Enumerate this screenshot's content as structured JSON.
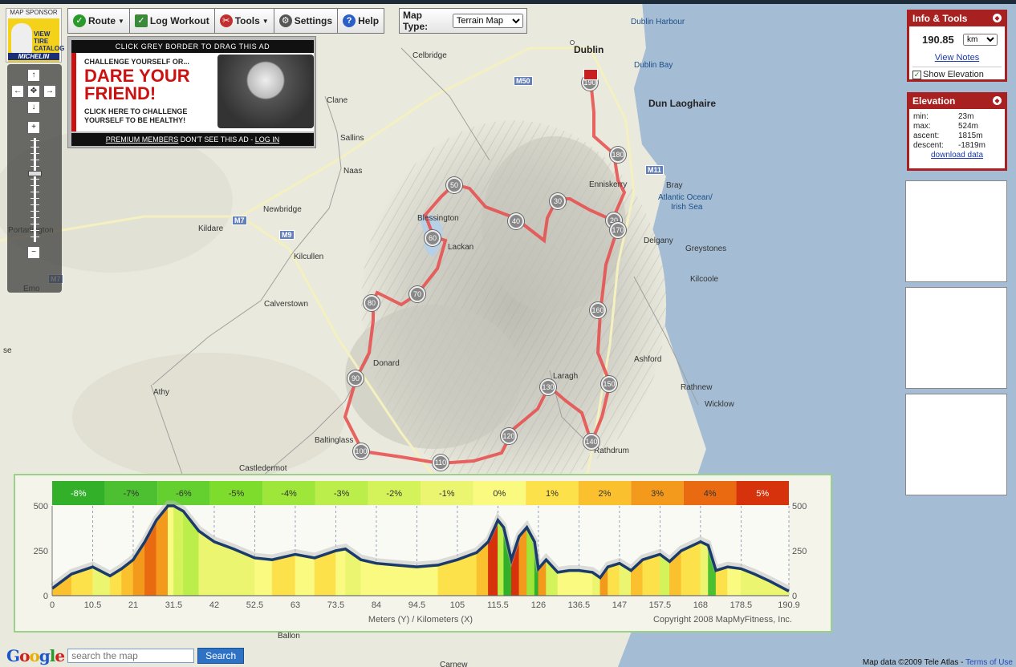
{
  "sponsor": {
    "label": "MAP SPONSOR",
    "cta": "VIEW TIRE CATALOG",
    "brand": "MICHELIN"
  },
  "toolbar": {
    "items": [
      {
        "label": "Route",
        "icon": "check-icon",
        "has_menu": true
      },
      {
        "label": "Log Workout",
        "icon": "clipboard-check-icon",
        "has_menu": false
      },
      {
        "label": "Tools",
        "icon": "tools-icon",
        "has_menu": true
      },
      {
        "label": "Settings",
        "icon": "gear-icon",
        "has_menu": false
      },
      {
        "label": "Help",
        "icon": "help-icon",
        "has_menu": false
      }
    ],
    "map_type_label": "Map Type:",
    "map_type_value": "Terrain Map"
  },
  "ad": {
    "header": "CLICK GREY BORDER TO DRAG THIS AD",
    "line1": "CHALLENGE YOURSELF OR...",
    "headline": "DARE YOUR FRIEND!",
    "line3": "CLICK HERE TO CHALLENGE YOURSELF TO BE HEALTHY!",
    "footer_link1": "PREMIUM MEMBERS",
    "footer_mid": " DON'T SEE THIS AD - ",
    "footer_link2": "LOG IN"
  },
  "info_tools": {
    "title": "Info & Tools",
    "distance": "190.85",
    "unit": "km",
    "view_notes": "View Notes",
    "show_elevation": "Show Elevation",
    "show_elevation_checked": true
  },
  "elevation": {
    "title": "Elevation",
    "rows": [
      {
        "k": "min:",
        "v": "23m"
      },
      {
        "k": "max:",
        "v": "524m"
      },
      {
        "k": "ascent:",
        "v": "1815m"
      },
      {
        "k": "descent:",
        "v": "-1819m"
      }
    ],
    "download": "download data"
  },
  "places": [
    {
      "name": "Dublin",
      "cls": "big"
    },
    {
      "name": "Dublin Harbour",
      "cls": "sea"
    },
    {
      "name": "Dublin Bay",
      "cls": "sea"
    },
    {
      "name": "Dun Laoghaire",
      "cls": "big"
    },
    {
      "name": "Celbridge",
      "cls": ""
    },
    {
      "name": "Clane",
      "cls": ""
    },
    {
      "name": "Sallins",
      "cls": ""
    },
    {
      "name": "Naas",
      "cls": ""
    },
    {
      "name": "Newbridge",
      "cls": ""
    },
    {
      "name": "Kildare",
      "cls": ""
    },
    {
      "name": "Portarlington",
      "cls": ""
    },
    {
      "name": "Kilcullen",
      "cls": ""
    },
    {
      "name": "Calverstown",
      "cls": ""
    },
    {
      "name": "Blessington",
      "cls": ""
    },
    {
      "name": "Lackan",
      "cls": ""
    },
    {
      "name": "Enniskerry",
      "cls": ""
    },
    {
      "name": "Bray",
      "cls": ""
    },
    {
      "name": "Atlantic Ocean/",
      "cls": "sea"
    },
    {
      "name": "Irish Sea",
      "cls": "sea"
    },
    {
      "name": "Delgany",
      "cls": ""
    },
    {
      "name": "Greystones",
      "cls": ""
    },
    {
      "name": "Kilcoole",
      "cls": ""
    },
    {
      "name": "Ashford",
      "cls": ""
    },
    {
      "name": "Rathnew",
      "cls": ""
    },
    {
      "name": "Wicklow",
      "cls": ""
    },
    {
      "name": "Laragh",
      "cls": ""
    },
    {
      "name": "Rathdrum",
      "cls": ""
    },
    {
      "name": "Donard",
      "cls": ""
    },
    {
      "name": "Athy",
      "cls": ""
    },
    {
      "name": "Baltinglass",
      "cls": ""
    },
    {
      "name": "Castledermot",
      "cls": ""
    },
    {
      "name": "Ballon",
      "cls": ""
    },
    {
      "name": "Carnew",
      "cls": ""
    },
    {
      "name": "Emo",
      "cls": ""
    },
    {
      "name": "se",
      "cls": ""
    }
  ],
  "road_shields": [
    "M50",
    "M11",
    "M7",
    "M9",
    "M7"
  ],
  "km_markers": [
    "190",
    "180",
    "30",
    "20",
    "170",
    "50",
    "40",
    "60",
    "70",
    "80",
    "160",
    "90",
    "130",
    "150",
    "120",
    "140",
    "100",
    "110"
  ],
  "chart_data": {
    "type": "area",
    "xlabel": "Meters (Y) / Kilometers (X)",
    "copyright": "Copyright 2008 MapMyFitness, Inc.",
    "x_ticks": [
      "0",
      "10.5",
      "21",
      "31.5",
      "42",
      "52.5",
      "63",
      "73.5",
      "84",
      "94.5",
      "105",
      "115.5",
      "126",
      "136.5",
      "147",
      "157.5",
      "168",
      "178.5",
      "190.9"
    ],
    "y_ticks": [
      "0",
      "250",
      "500"
    ],
    "ylim": [
      0,
      500
    ],
    "xlim": [
      0,
      190.9
    ],
    "grade_legend": [
      "-8%",
      "-7%",
      "-6%",
      "-5%",
      "-4%",
      "-3%",
      "-2%",
      "-1%",
      "0%",
      "1%",
      "2%",
      "3%",
      "4%",
      "5%"
    ],
    "grade_colors": [
      "#33b02a",
      "#4cc030",
      "#63d02f",
      "#7ddc2c",
      "#9ee63a",
      "#bbee4a",
      "#d4f25a",
      "#ecf570",
      "#fafa80",
      "#fde14a",
      "#fbc02d",
      "#f39a1c",
      "#e96a10",
      "#d6320b"
    ],
    "profile_x": [
      0,
      5,
      10.5,
      15,
      18,
      21,
      24,
      27,
      30,
      31.5,
      34,
      38,
      42,
      47,
      52.5,
      57,
      63,
      68,
      73.5,
      76,
      80,
      84,
      89,
      94.5,
      100,
      105,
      110,
      113,
      115.5,
      117,
      119,
      121,
      123,
      125,
      126,
      128,
      131,
      134,
      136.5,
      140,
      142,
      144,
      147,
      150,
      153,
      157.5,
      160,
      163,
      166,
      168,
      170,
      172,
      175,
      178.5,
      182,
      186,
      190.9
    ],
    "profile_y": [
      40,
      120,
      160,
      110,
      150,
      200,
      300,
      420,
      520,
      520,
      470,
      360,
      300,
      260,
      210,
      200,
      230,
      210,
      250,
      260,
      200,
      180,
      170,
      160,
      170,
      200,
      240,
      300,
      420,
      380,
      200,
      330,
      380,
      300,
      150,
      200,
      130,
      140,
      140,
      130,
      100,
      160,
      180,
      140,
      200,
      230,
      190,
      250,
      280,
      300,
      280,
      140,
      160,
      150,
      120,
      80,
      25
    ]
  },
  "search": {
    "logo": "Google",
    "placeholder": "search the map",
    "button": "Search"
  },
  "copyright": {
    "text": "Map data ©2009 Tele Atlas - ",
    "link": "Terms of Use"
  }
}
